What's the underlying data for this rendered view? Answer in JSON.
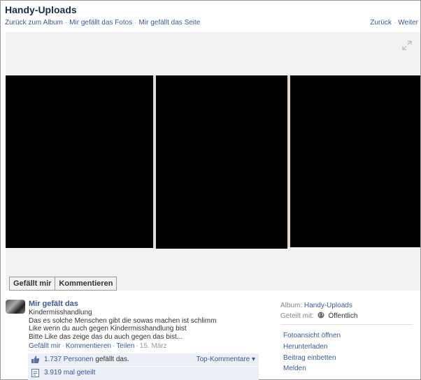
{
  "album_title": "Handy-Uploads",
  "nav_left": [
    "Zurück zum Album",
    "Mir gefällt das Fotos",
    "Mir gefällt das Seite"
  ],
  "nav_right": [
    "Zurück",
    "Weiter"
  ],
  "actions": {
    "like": "Gefällt mir",
    "comment": "Kommentieren"
  },
  "post": {
    "author": "Mir gefält das",
    "lines": [
      "Kindermisshandlung",
      "Das es solche Menschen gibt die sowas machen ist schlimm",
      "Like wenn du auch gegen Kindermisshandlung bist",
      "Bitte Like das zeige das du auch gegen das bist..."
    ],
    "meta": {
      "like": "Gefällt mir",
      "comment": "Kommentieren",
      "share": "Teilen",
      "date": "15. März"
    }
  },
  "likes": {
    "count": "1.737 Personen",
    "suffix": "gefällt das.",
    "top_comments": "Top-Kommentare ▾",
    "shares": "3.919 mal geteilt"
  },
  "sidebar": {
    "album_label": "Album:",
    "album_value": "Handy-Uploads",
    "shared_label": "Geteilt mit:",
    "shared_value": "Öffentlich",
    "actions": [
      "Fotoansicht öffnen",
      "Herunterladen",
      "Beitrag einbetten",
      "Melden"
    ]
  },
  "colors": {
    "link": "#3b5998",
    "stage_bg": "#f2f2f2",
    "likebox_bg": "#eceff5"
  },
  "icons": [
    "expand-icon",
    "thumbs-up-icon",
    "share-icon",
    "globe-icon"
  ]
}
